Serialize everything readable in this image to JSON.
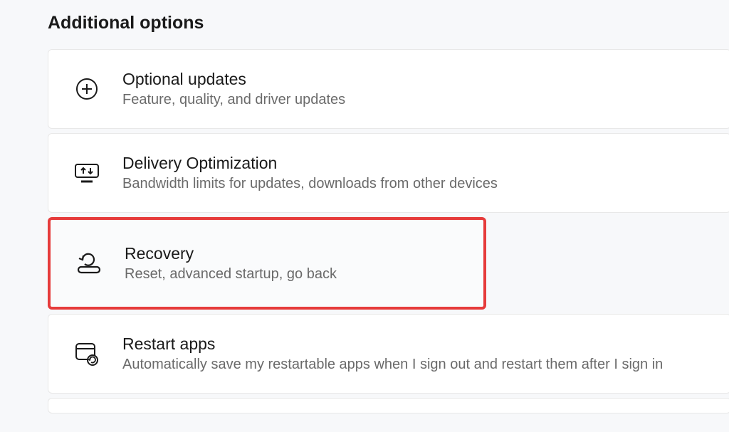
{
  "section_title": "Additional options",
  "options": [
    {
      "title": "Optional updates",
      "description": "Feature, quality, and driver updates"
    },
    {
      "title": "Delivery Optimization",
      "description": "Bandwidth limits for updates, downloads from other devices"
    },
    {
      "title": "Recovery",
      "description": "Reset, advanced startup, go back"
    },
    {
      "title": "Restart apps",
      "description": "Automatically save my restartable apps when I sign out and restart them after I sign in"
    }
  ]
}
